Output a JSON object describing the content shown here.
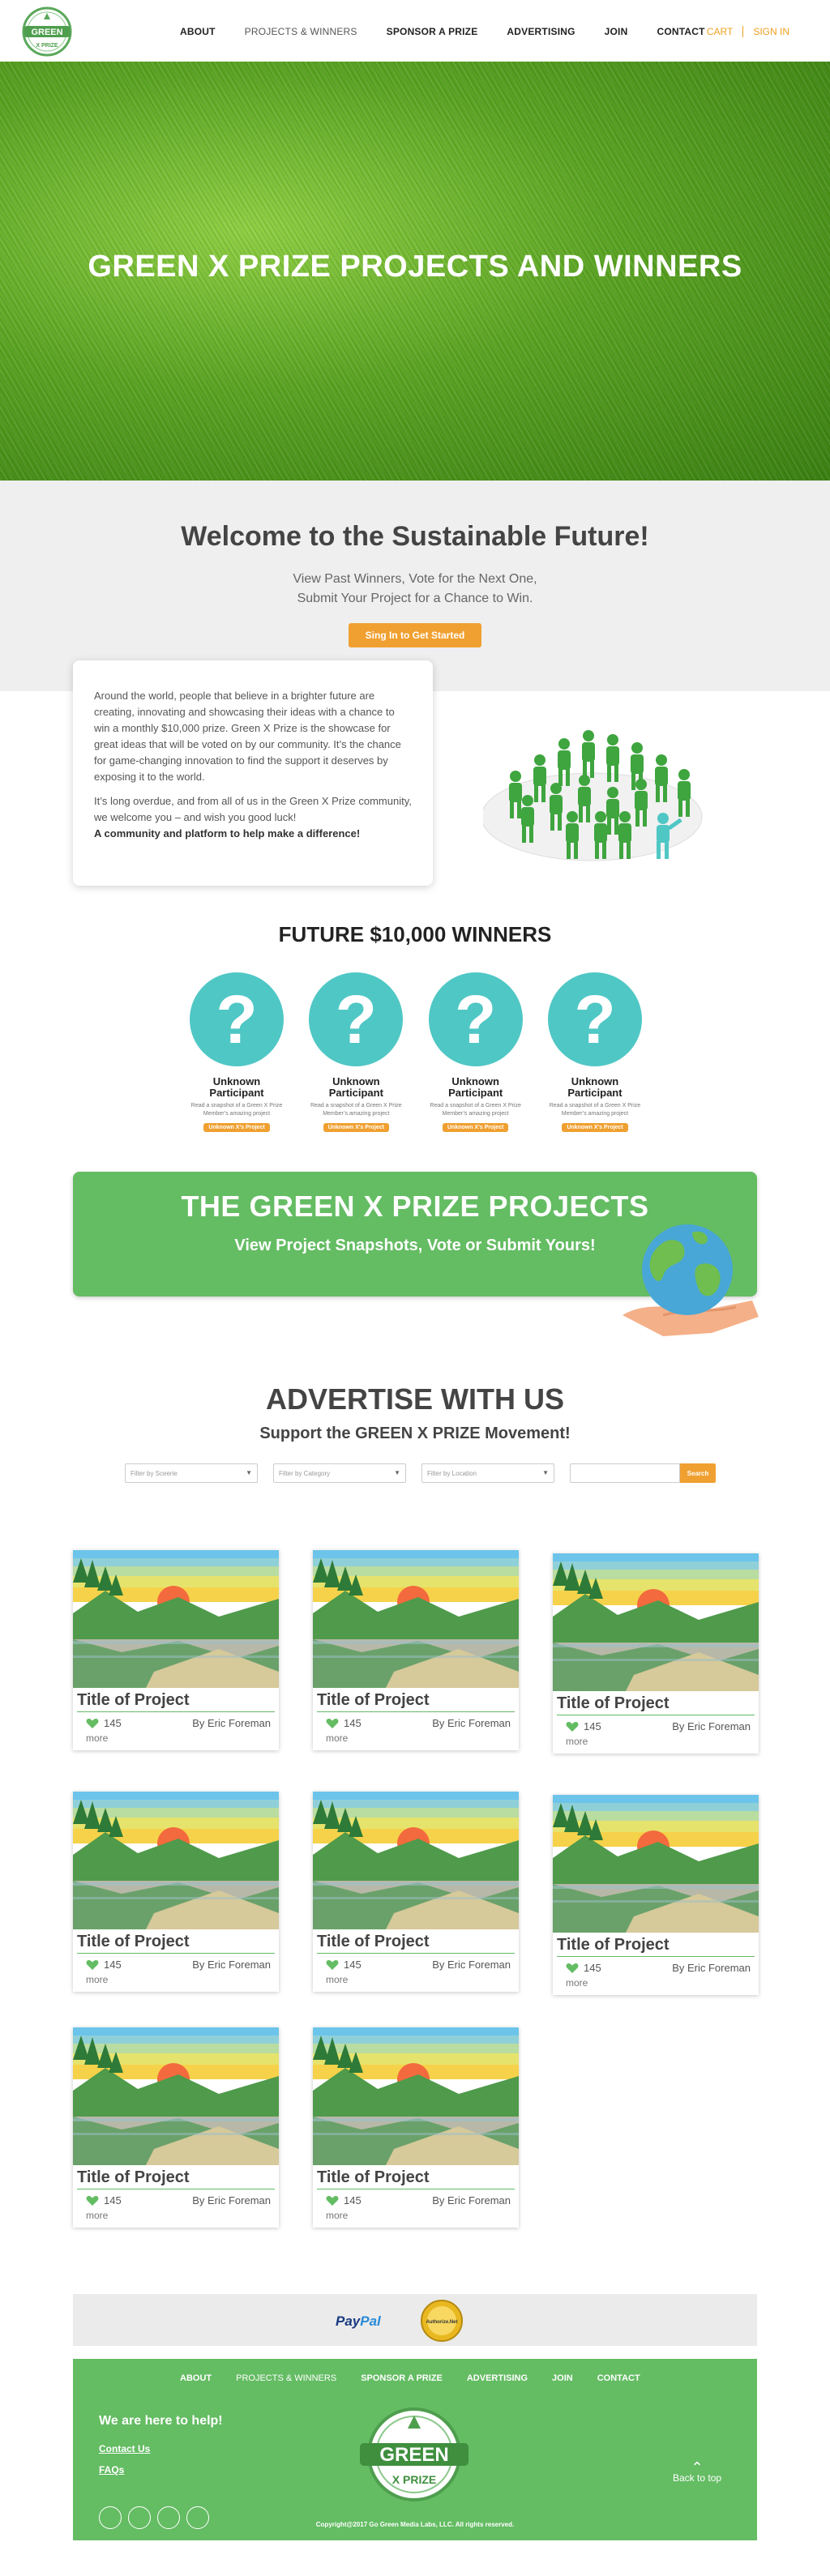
{
  "header": {
    "logo_text": "GREEN X PRIZE",
    "nav": [
      {
        "label": "ABOUT",
        "active": false
      },
      {
        "label": "PROJECTS & WINNERS",
        "active": true
      },
      {
        "label": "SPONSOR A PRIZE",
        "active": false
      },
      {
        "label": "ADVERTISING",
        "active": false
      },
      {
        "label": "JOIN",
        "active": false
      },
      {
        "label": "CONTACT",
        "active": false
      }
    ],
    "cart": "CART",
    "signin": "SIGN IN"
  },
  "hero": {
    "title": "GREEN X PRIZE PROJECTS AND WINNERS"
  },
  "welcome": {
    "title": "Welcome to the Sustainable Future!",
    "line1": "View Past Winners, Vote for the Next One,",
    "line2": "Submit Your Project for a Chance to Win.",
    "button": "Sing In to Get Started"
  },
  "intro": {
    "p1": "Around the world, people that believe in a brighter future are creating, innovating and showcasing their ideas with a chance to win a monthly $10,000 prize.  Green X Prize is the showcase for great ideas that will be voted on by our community.  It’s the chance for game-changing innovation to find the support it deserves by exposing it to the world.",
    "p2": "It’s long overdue, and from all of us in the Green X Prize community, we welcome you – and wish you good luck!",
    "p3": "A community and platform to help make a difference!"
  },
  "future_winners": {
    "title": "FUTURE $10,000 WINNERS",
    "items": [
      {
        "mark": "?",
        "name1": "Unknown",
        "name2": "Participant",
        "desc1": "Read a snapshot of a Green X Prize",
        "desc2": "Member’s amazing project",
        "button": "Unknown X's Project"
      },
      {
        "mark": "?",
        "name1": "Unknown",
        "name2": "Participant",
        "desc1": "Read a snapshot of a Green X Prize",
        "desc2": "Member’s amazing project",
        "button": "Unknown X's Project"
      },
      {
        "mark": "?",
        "name1": "Unknown",
        "name2": "Participant",
        "desc1": "Read a snapshot of a Green X Prize",
        "desc2": "Member’s amazing project",
        "button": "Unknown X's Project"
      },
      {
        "mark": "?",
        "name1": "Unknown",
        "name2": "Participant",
        "desc1": "Read a snapshot of a Green X Prize",
        "desc2": "Member’s amazing project",
        "button": "Unknown X's Project"
      }
    ]
  },
  "projects_banner": {
    "title": "THE GREEN X PRIZE PROJECTS",
    "subtitle": "View Project Snapshots, Vote or Submit Yours!"
  },
  "advertise": {
    "title": "ADVERTISE WITH US",
    "subtitle": "Support the GREEN X PRIZE Movement!",
    "filters": [
      "Filter by Sceerie",
      "Filter by Category",
      "Filter by Location"
    ],
    "search_placeholder": "",
    "search_button": "Search"
  },
  "projects": [
    {
      "title": "Title of Project",
      "likes": "145",
      "author": "By Eric Foreman",
      "more": "more"
    },
    {
      "title": "Title of Project",
      "likes": "145",
      "author": "By Eric Foreman",
      "more": "more"
    },
    {
      "title": "Title of Project",
      "likes": "145",
      "author": "By Eric Foreman",
      "more": "more"
    },
    {
      "title": "Title of Project",
      "likes": "145",
      "author": "By Eric Foreman",
      "more": "more"
    },
    {
      "title": "Title of Project",
      "likes": "145",
      "author": "By Eric Foreman",
      "more": "more"
    },
    {
      "title": "Title of Project",
      "likes": "145",
      "author": "By Eric Foreman",
      "more": "more"
    },
    {
      "title": "Title of Project",
      "likes": "145",
      "author": "By Eric Foreman",
      "more": "more"
    },
    {
      "title": "Title of Project",
      "likes": "145",
      "author": "By Eric Foreman",
      "more": "more"
    }
  ],
  "payments": {
    "paypal_1": "Pay",
    "paypal_2": "Pal",
    "authnet": "Authorize.Net"
  },
  "footer": {
    "nav": [
      {
        "label": "ABOUT",
        "active": false
      },
      {
        "label": "PROJECTS & WINNERS",
        "active": true
      },
      {
        "label": "SPONSOR A PRIZE",
        "active": false
      },
      {
        "label": "ADVERTISING",
        "active": false
      },
      {
        "label": "JOIN",
        "active": false
      },
      {
        "label": "CONTACT",
        "active": false
      }
    ],
    "help": "We are here to help!",
    "contact": "Contact Us",
    "faqs": "FAQs",
    "back_to_top": "Back to top",
    "copyright": "Copyright@2017 Go Green Media Labs, LLC. All rights reserved."
  },
  "colors": {
    "green": "#64bc63",
    "orange": "#f0a030",
    "teal": "#4fc7c5"
  }
}
